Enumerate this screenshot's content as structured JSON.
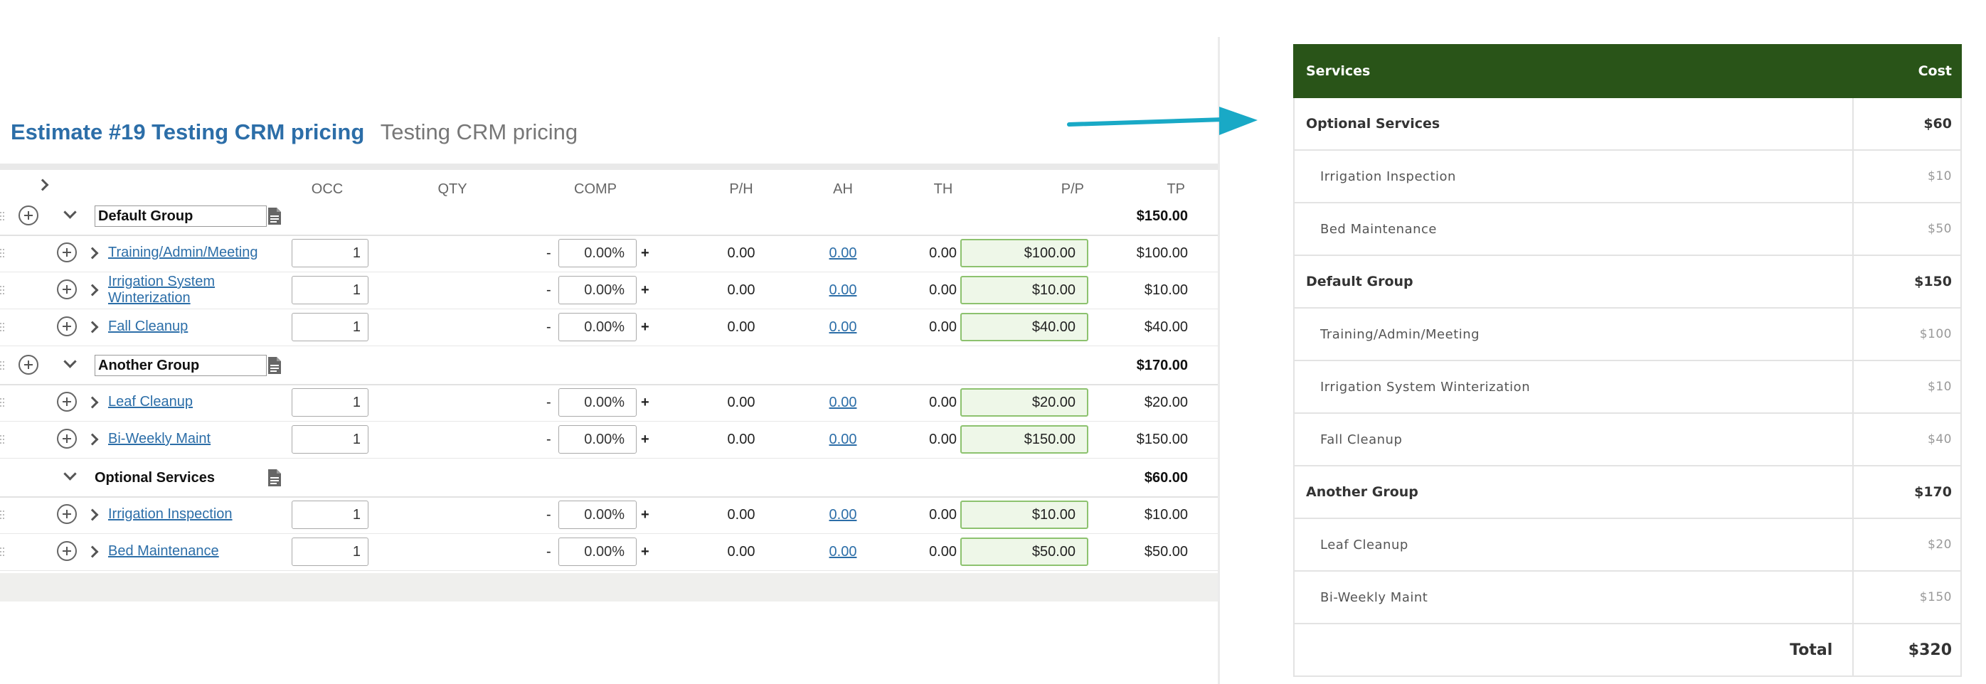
{
  "estimate": {
    "title": "Estimate #19 Testing CRM pricing",
    "subtitle": "Testing CRM pricing"
  },
  "columns": {
    "occ": "OCC",
    "qty": "QTY",
    "comp": "COMP",
    "ph": "P/H",
    "ah": "AH",
    "th": "TH",
    "pp": "P/P",
    "tp": "TP"
  },
  "groups": [
    {
      "name": "Default Group",
      "total": "$150.00",
      "items": [
        {
          "name": "Training/Admin/Meeting",
          "occ": "1",
          "comp": "0.00%",
          "ph": "0.00",
          "ah": "0.00",
          "th": "0.00",
          "pp": "$100.00",
          "tp": "$100.00"
        },
        {
          "name": "Irrigation System Winterization",
          "occ": "1",
          "comp": "0.00%",
          "ph": "0.00",
          "ah": "0.00",
          "th": "0.00",
          "pp": "$10.00",
          "tp": "$10.00"
        },
        {
          "name": "Fall Cleanup",
          "occ": "1",
          "comp": "0.00%",
          "ph": "0.00",
          "ah": "0.00",
          "th": "0.00",
          "pp": "$40.00",
          "tp": "$40.00"
        }
      ]
    },
    {
      "name": "Another Group",
      "total": "$170.00",
      "items": [
        {
          "name": "Leaf Cleanup",
          "occ": "1",
          "comp": "0.00%",
          "ph": "0.00",
          "ah": "0.00",
          "th": "0.00",
          "pp": "$20.00",
          "tp": "$20.00"
        },
        {
          "name": "Bi-Weekly Maint",
          "occ": "1",
          "comp": "0.00%",
          "ph": "0.00",
          "ah": "0.00",
          "th": "0.00",
          "pp": "$150.00",
          "tp": "$150.00"
        }
      ]
    },
    {
      "name": "Optional Services",
      "total": "$60.00",
      "items": [
        {
          "name": "Irrigation Inspection",
          "occ": "1",
          "comp": "0.00%",
          "ph": "0.00",
          "ah": "0.00",
          "th": "0.00",
          "pp": "$10.00",
          "tp": "$10.00"
        },
        {
          "name": "Bed Maintenance",
          "occ": "1",
          "comp": "0.00%",
          "ph": "0.00",
          "ah": "0.00",
          "th": "0.00",
          "pp": "$50.00",
          "tp": "$50.00"
        }
      ]
    }
  ],
  "comp_minus": "-",
  "comp_plus": "+",
  "services": {
    "header": {
      "services": "Services",
      "cost": "Cost"
    },
    "rows": [
      {
        "type": "group",
        "name": "Optional Services",
        "cost": "$60"
      },
      {
        "type": "item",
        "name": "Irrigation Inspection",
        "cost": "$10"
      },
      {
        "type": "item",
        "name": "Bed Maintenance",
        "cost": "$50"
      },
      {
        "type": "group",
        "name": "Default Group",
        "cost": "$150"
      },
      {
        "type": "item",
        "name": "Training/Admin/Meeting",
        "cost": "$100"
      },
      {
        "type": "item",
        "name": "Irrigation System Winterization",
        "cost": "$10"
      },
      {
        "type": "item",
        "name": "Fall Cleanup",
        "cost": "$40"
      },
      {
        "type": "group",
        "name": "Another Group",
        "cost": "$170"
      },
      {
        "type": "item",
        "name": "Leaf Cleanup",
        "cost": "$20"
      },
      {
        "type": "item",
        "name": "Bi-Weekly Maint",
        "cost": "$150"
      }
    ],
    "total_label": "Total",
    "total_value": "$320"
  },
  "colors": {
    "accent_blue": "#2c6ea8",
    "header_green": "#295418",
    "pp_fill": "#eef7e8",
    "pp_border": "#8dc26f",
    "arrow": "#19a9c6"
  },
  "icons": [
    "chevron-right-icon",
    "chevron-down-icon",
    "plus-circle-icon",
    "document-icon",
    "drag-handle-icon",
    "arrow-right-icon"
  ]
}
